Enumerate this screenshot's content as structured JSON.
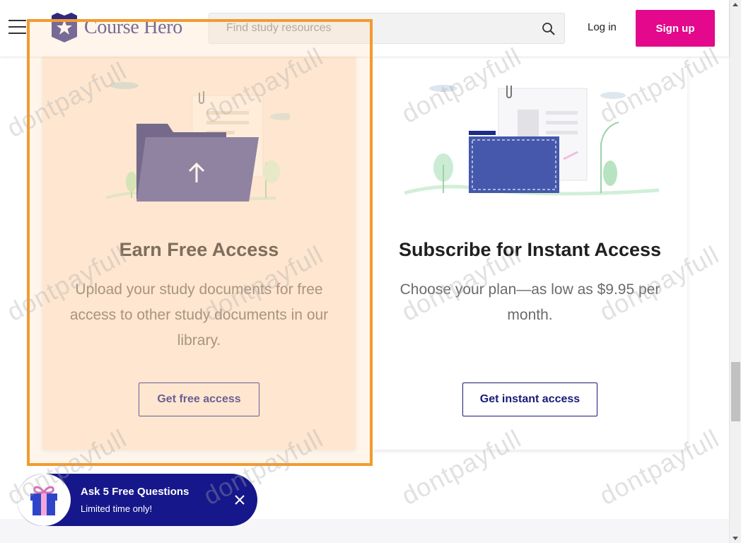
{
  "header": {
    "logo_text": "Course Hero",
    "search_placeholder": "Find study resources",
    "login_label": "Log in",
    "signup_label": "Sign up"
  },
  "cards": {
    "earn": {
      "title": "Earn Free Access",
      "description": "Upload your study documents for free access to other study documents in our library.",
      "button_label": "Get free access"
    },
    "subscribe": {
      "title": "Subscribe for Instant Access",
      "description": "Choose your plan—as low as $9.95 per month.",
      "button_label": "Get instant access"
    }
  },
  "promo": {
    "title": "Ask 5 Free Questions",
    "subtitle": "Limited time only!"
  },
  "watermark": "dontpayfull",
  "colors": {
    "brand": "#2e2a7e",
    "signup": "#e3088c",
    "button_text": "#1a1a7a",
    "highlight": "#f29b2e",
    "promo_bg": "#16178a"
  },
  "icons": [
    "menu-icon",
    "search-icon",
    "gift-icon",
    "close-icon",
    "folder-upload-illustration",
    "document-folder-illustration"
  ]
}
